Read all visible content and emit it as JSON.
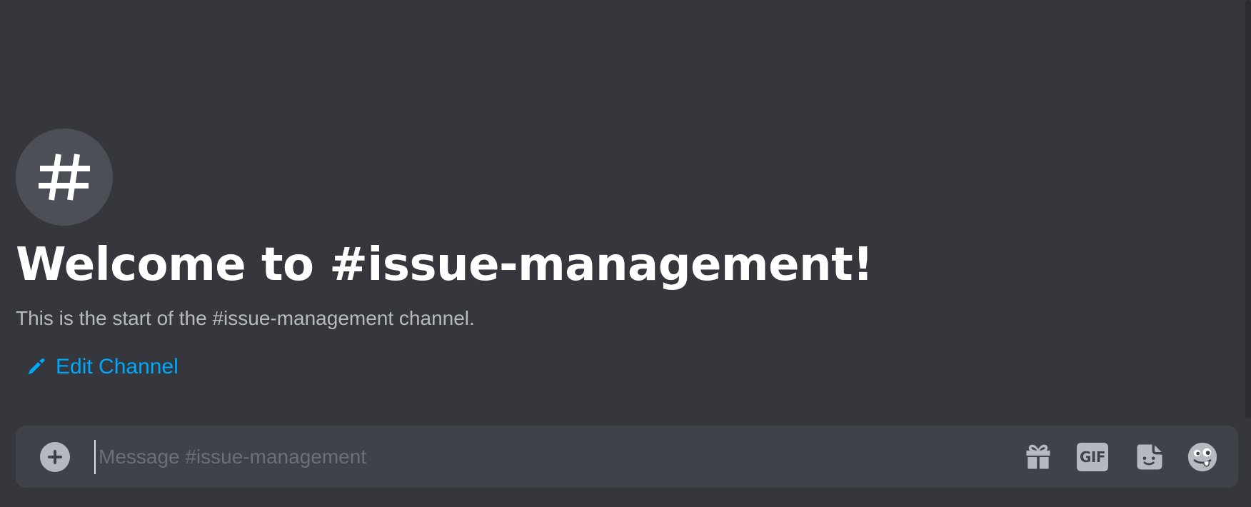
{
  "channel": {
    "avatar_glyph": "#",
    "welcome_title": "Welcome to #issue-management!",
    "welcome_subtitle": "This is the start of the #issue-management channel.",
    "edit_label": "Edit Channel"
  },
  "composer": {
    "placeholder": "Message #issue-management",
    "value": "",
    "gif_label": "GIF"
  },
  "icons": {
    "attach": "plus-circle-icon",
    "edit": "pencil-icon",
    "gift": "gift-icon",
    "gif": "gif-icon",
    "sticker": "sticker-icon",
    "emoji": "emoji-icon"
  },
  "colors": {
    "background": "#36373d",
    "composer_background": "#404249",
    "link": "#00a8fc",
    "title": "#ffffff",
    "subtitle": "#b5bac1",
    "icon": "#b5bac1"
  }
}
